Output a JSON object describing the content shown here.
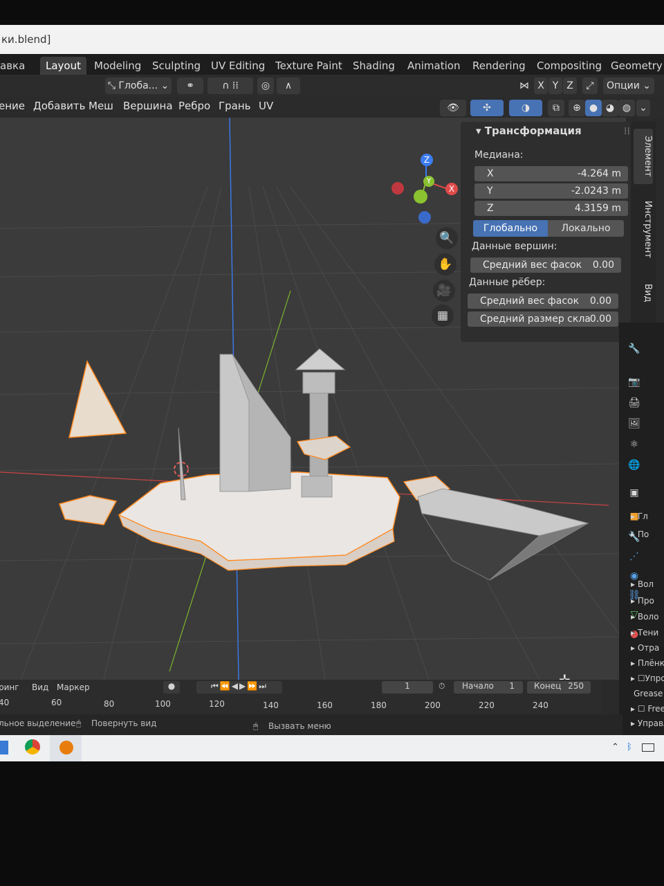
{
  "title": "ки.blend]",
  "workspace_tabs": [
    "авка",
    "Layout",
    "Modeling",
    "Sculpting",
    "UV Editing",
    "Texture Paint",
    "Shading",
    "Animation",
    "Rendering",
    "Compositing",
    "Geometry"
  ],
  "header": {
    "orientation": "Глоба...",
    "axes": [
      "X",
      "Y",
      "Z"
    ],
    "options": "Опции"
  },
  "menu": [
    "ение",
    "Добавить",
    "Меш",
    "Вершина",
    "Ребро",
    "Грань",
    "UV"
  ],
  "gizmo": {
    "z": "Z",
    "y": "Y",
    "x": "X"
  },
  "npanel": {
    "title": "Трансформация",
    "median": "Медиана:",
    "x_label": "X",
    "x_value": "-4.264 m",
    "y_label": "Y",
    "y_value": "-2.0243 m",
    "z_label": "Z",
    "z_value": "4.3159 m",
    "global": "Глобально",
    "local": "Локально",
    "vertex_data": "Данные вершин:",
    "bevel_weight": "Средний вес фасок",
    "bevel_weight_value": "0.00",
    "edge_data": "Данные рёбер:",
    "edge_bevel_weight": "Средний вес фасок",
    "edge_bevel_weight_value": "0.00",
    "crease": "Средний размер скла",
    "crease_value": "0.00"
  },
  "side_tabs": [
    "Элемент",
    "Инструмент",
    "Вид"
  ],
  "props_tree": [
    "Гл",
    "По",
    "Вол",
    "Про",
    "Воло",
    "Тени",
    "Отра",
    "Плёнк",
    "Упро",
    "Grease",
    "Frees",
    "Управле"
  ],
  "timeline": {
    "menus": [
      "ринг",
      "Вид",
      "Маркер"
    ],
    "current_frame": "1",
    "start_label": "Начало",
    "start": "1",
    "end_label": "Конец",
    "end": "250",
    "ticks": [
      "40",
      "60",
      "80",
      "100",
      "120",
      "140",
      "160",
      "180",
      "200",
      "220",
      "240"
    ]
  },
  "status": {
    "left": "льное выделение",
    "rotate": "Повернуть вид",
    "menu": "Вызвать меню"
  },
  "colors": {
    "accent": "#4772b3",
    "selected": "#ff8a1f",
    "axis_x": "#e04a4a",
    "axis_y": "#8ac230",
    "axis_z": "#3c7cf0"
  }
}
